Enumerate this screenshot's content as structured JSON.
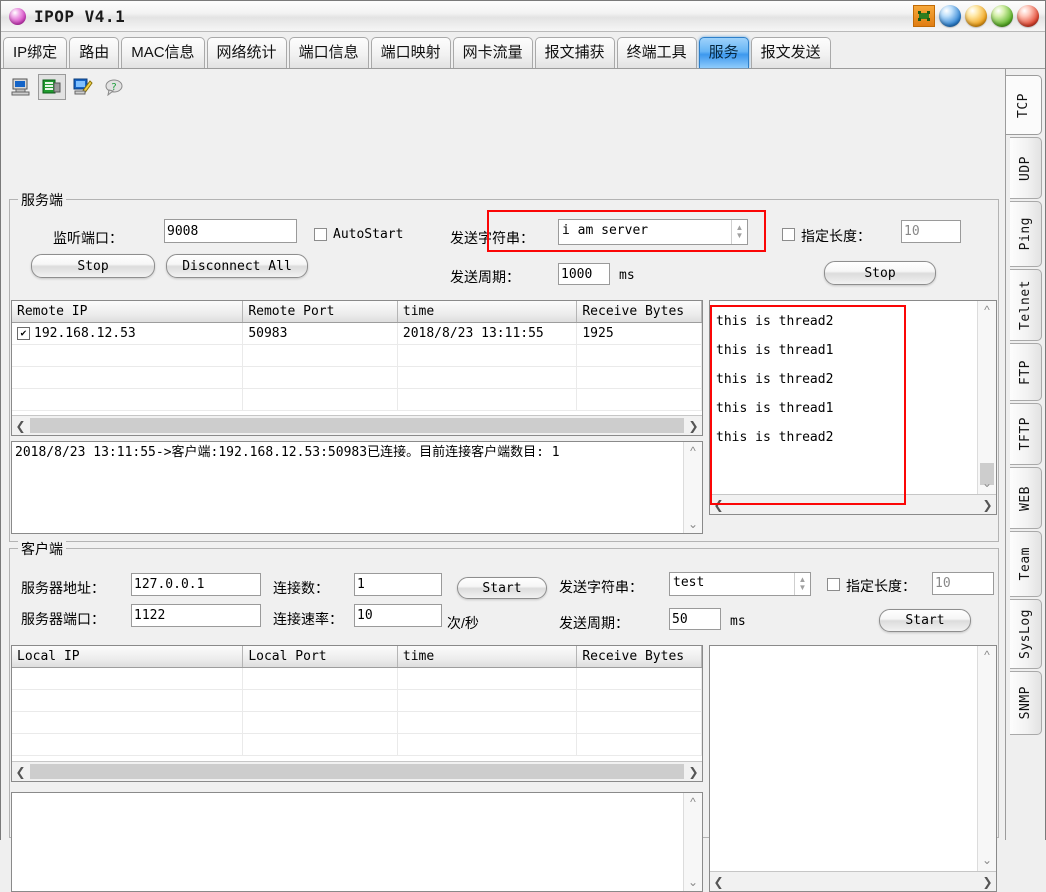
{
  "window": {
    "title": "IPOP V4.1",
    "sys_buttons": [
      "pin-icon",
      "minimize-orb",
      "maximize-orb",
      "restore-orb",
      "close-orb"
    ]
  },
  "tabs": {
    "items": [
      {
        "label": "IP绑定",
        "selected": false
      },
      {
        "label": "路由",
        "selected": false
      },
      {
        "label": "MAC信息",
        "selected": false
      },
      {
        "label": "网络统计",
        "selected": false
      },
      {
        "label": "端口信息",
        "selected": false
      },
      {
        "label": "端口映射",
        "selected": false
      },
      {
        "label": "网卡流量",
        "selected": false
      },
      {
        "label": "报文捕获",
        "selected": false
      },
      {
        "label": "终端工具",
        "selected": false
      },
      {
        "label": "服务",
        "selected": true
      },
      {
        "label": "报文发送",
        "selected": false
      }
    ]
  },
  "toolbar": {
    "icons": [
      "computer-icon",
      "server-icon",
      "edit-screen-icon",
      "help-balloon-icon"
    ]
  },
  "server": {
    "legend": "服务端",
    "listen_port_label": "监听端口：",
    "listen_port_value": "9008",
    "autostart_label": "AutoStart",
    "autostart_checked": false,
    "stop_button": "Stop",
    "disconnect_all_button": "Disconnect All",
    "send_string_label": "发送字符串：",
    "send_string_value": "i am server",
    "send_period_label": "发送周期：",
    "send_period_value": "1000",
    "send_period_unit": "ms",
    "fixed_length_label": "指定长度：",
    "fixed_length_value": "10",
    "fixed_length_checked": false,
    "send_stop_button": "Stop",
    "table": {
      "columns": [
        "Remote IP",
        "Remote Port",
        "time",
        "Receive Bytes"
      ],
      "rows": [
        {
          "checked": true,
          "remote_ip": "192.168.12.53",
          "remote_port": "50983",
          "time": "2018/8/23 13:11:55",
          "receive_bytes": "1925"
        }
      ]
    },
    "log": "2018/8/23 13:11:55->客户端:192.168.12.53:50983已连接。目前连接客户端数目: 1",
    "receive_lines": [
      "this is thread2",
      "this is thread1",
      "this is thread2",
      "this is thread1",
      "this is thread2"
    ]
  },
  "client": {
    "legend": "客户端",
    "server_addr_label": "服务器地址：",
    "server_addr_value": "127.0.0.1",
    "server_port_label": "服务器端口：",
    "server_port_value": "1122",
    "conn_count_label": "连接数：",
    "conn_count_value": "1",
    "conn_rate_label": "连接速率：",
    "conn_rate_value": "10",
    "conn_rate_unit": "次/秒",
    "start_button": "Start",
    "send_string_label": "发送字符串：",
    "send_string_value": "test",
    "send_period_label": "发送周期：",
    "send_period_value": "50",
    "send_period_unit": "ms",
    "fixed_length_label": "指定长度：",
    "fixed_length_value": "10",
    "fixed_length_checked": false,
    "send_start_button": "Start",
    "table": {
      "columns": [
        "Local IP",
        "Local Port",
        "time",
        "Receive Bytes"
      ],
      "rows": []
    },
    "log": "",
    "receive_text": ""
  },
  "side_tabs": {
    "items": [
      {
        "label": "TCP",
        "selected": true
      },
      {
        "label": "UDP",
        "selected": false
      },
      {
        "label": "Ping",
        "selected": false
      },
      {
        "label": "Telnet",
        "selected": false
      },
      {
        "label": "FTP",
        "selected": false
      },
      {
        "label": "TFTP",
        "selected": false
      },
      {
        "label": "WEB",
        "selected": false
      },
      {
        "label": "Team",
        "selected": false
      },
      {
        "label": "SysLog",
        "selected": false
      },
      {
        "label": "SNMP",
        "selected": false
      }
    ]
  },
  "annotations": {
    "highlight_color": "#fb0606",
    "boxes": [
      "send-string-highlight",
      "receive-lines-highlight"
    ]
  }
}
